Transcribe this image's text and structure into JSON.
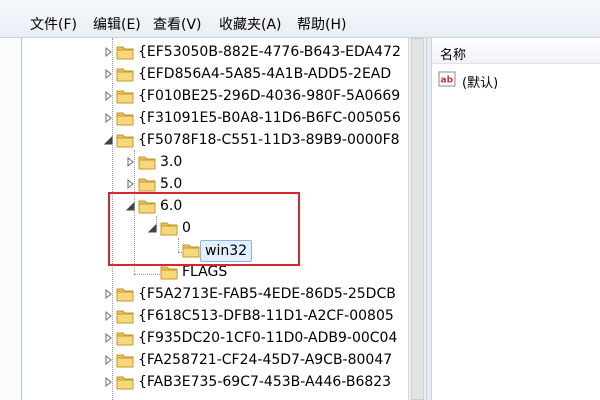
{
  "menu": [
    {
      "label": "文件(F)"
    },
    {
      "label": "编辑(E)"
    },
    {
      "label": "查看(V)"
    },
    {
      "label": "收藏夹(A)"
    },
    {
      "label": "帮助(H)"
    }
  ],
  "tree": {
    "nodes": [
      {
        "label": "{EF53050B-882E-4776-B643-EDA472",
        "expander": "right"
      },
      {
        "label": "{EFD856A4-5A85-4A1B-ADD5-2EAD",
        "expander": "right"
      },
      {
        "label": "{F010BE25-296D-4036-980F-5A0669",
        "expander": "right"
      },
      {
        "label": "{F31091E5-B0A8-11D6-B6FC-005056",
        "expander": "right"
      },
      {
        "label": "{F5078F18-C551-11D3-89B9-0000F8",
        "expander": "down"
      },
      {
        "label": "3.0",
        "expander": "right"
      },
      {
        "label": "5.0",
        "expander": "right"
      },
      {
        "label": "6.0",
        "expander": "down"
      },
      {
        "label": "0",
        "expander": "down"
      },
      {
        "label": "win32",
        "expander": "none",
        "selected": true
      },
      {
        "label": "FLAGS",
        "expander": "none"
      },
      {
        "label": "{F5A2713E-FAB5-4EDE-86D5-25DCB",
        "expander": "right"
      },
      {
        "label": "{F618C513-DFB8-11D1-A2CF-00805",
        "expander": "right"
      },
      {
        "label": "{F935DC20-1CF0-11D0-ADB9-00C04",
        "expander": "right"
      },
      {
        "label": "{FA258721-CF24-45D7-A9CB-80047",
        "expander": "right"
      },
      {
        "label": "{FAB3E735-69C7-453B-A446-B6823",
        "expander": "right"
      }
    ]
  },
  "values": {
    "column_name": "名称",
    "rows": [
      {
        "name": "(默认)",
        "icon": "string-value-icon"
      }
    ]
  },
  "colors": {
    "selection": "#e1efff",
    "highlight_box": "#d9262a"
  }
}
